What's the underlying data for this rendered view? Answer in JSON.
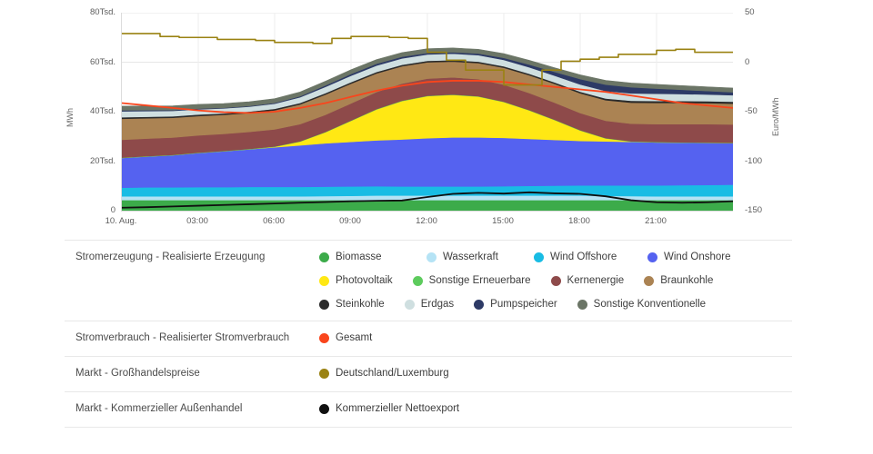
{
  "chart_data": {
    "type": "area",
    "title": "",
    "xlabel": "",
    "ylabel": "MWh",
    "y2label": "Euro/MWh",
    "grid": true,
    "legend_position": "bottom-table",
    "ylim": [
      0,
      80000
    ],
    "y2lim": [
      -150,
      50
    ],
    "y_ticks": [
      "0",
      "20Tsd.",
      "40Tsd.",
      "60Tsd.",
      "80Tsd."
    ],
    "y_tick_values": [
      0,
      20000,
      40000,
      60000,
      80000
    ],
    "y2_ticks": [
      "-150",
      "-100",
      "-50",
      "0",
      "50"
    ],
    "y2_tick_values": [
      -150,
      -100,
      -50,
      0,
      50
    ],
    "x_ticks": [
      "10. Aug.",
      "03:00",
      "06:00",
      "09:00",
      "12:00",
      "15:00",
      "18:00",
      "21:00"
    ],
    "x_hours": [
      0,
      3,
      6,
      9,
      12,
      15,
      18,
      21
    ],
    "x_range_hours": [
      0,
      24
    ],
    "stack_order": [
      "Biomasse",
      "Wasserkraft",
      "Wind Offshore",
      "Wind Onshore",
      "Photovoltaik",
      "Sonstige Erneuerbare",
      "Kernenergie",
      "Braunkohle",
      "Steinkohle",
      "Erdgas",
      "Pumpspeicher",
      "Sonstige Konventionelle"
    ],
    "x": [
      0,
      1,
      2,
      3,
      4,
      5,
      6,
      7,
      8,
      9,
      10,
      11,
      12,
      13,
      14,
      15,
      16,
      17,
      18,
      19,
      20,
      21,
      22,
      23,
      24
    ],
    "series": [
      {
        "name": "Biomasse",
        "color": "#3cab4a",
        "values": [
          4300,
          4300,
          4300,
          4300,
          4300,
          4300,
          4300,
          4300,
          4300,
          4300,
          4300,
          4300,
          4300,
          4300,
          4300,
          4300,
          4300,
          4300,
          4300,
          4300,
          4300,
          4300,
          4300,
          4300,
          4300
        ]
      },
      {
        "name": "Wasserkraft",
        "color": "#b5e3f5",
        "values": [
          1500,
          1500,
          1500,
          1500,
          1500,
          1500,
          1500,
          1500,
          1600,
          1700,
          1800,
          1800,
          1800,
          1800,
          1800,
          1800,
          1800,
          1800,
          1800,
          1700,
          1600,
          1500,
          1500,
          1500,
          1500
        ]
      },
      {
        "name": "Wind Offshore",
        "color": "#19bce4",
        "values": [
          3500,
          3600,
          3600,
          3700,
          3700,
          3800,
          3800,
          3800,
          3800,
          3800,
          3800,
          3700,
          3700,
          3700,
          3700,
          3800,
          3900,
          4000,
          4100,
          4200,
          4300,
          4400,
          4500,
          4600,
          4700
        ]
      },
      {
        "name": "Wind Onshore",
        "color": "#5562f0",
        "values": [
          12000,
          12500,
          13000,
          13800,
          14500,
          15200,
          16000,
          16800,
          17500,
          18000,
          18500,
          19000,
          19500,
          19800,
          19800,
          19500,
          19000,
          18500,
          18000,
          17800,
          17600,
          17400,
          17200,
          17000,
          16800
        ]
      },
      {
        "name": "Photovoltaik",
        "color": "#ffe814",
        "values": [
          0,
          0,
          0,
          0,
          0,
          0,
          200,
          1500,
          4500,
          8500,
          12500,
          15500,
          17000,
          17200,
          16500,
          14500,
          11500,
          8000,
          4200,
          1200,
          100,
          0,
          0,
          0,
          0
        ]
      },
      {
        "name": "Sonstige Erneuerbare",
        "color": "#5dcb5d",
        "values": [
          150,
          150,
          150,
          150,
          150,
          150,
          150,
          150,
          150,
          150,
          150,
          150,
          150,
          150,
          150,
          150,
          150,
          150,
          150,
          150,
          150,
          150,
          150,
          150,
          150
        ]
      },
      {
        "name": "Kernenergie",
        "color": "#8e4a4a",
        "values": [
          7200,
          7100,
          7000,
          7000,
          6900,
          6900,
          6900,
          6900,
          6900,
          6900,
          6900,
          6900,
          6900,
          6900,
          6900,
          6900,
          6900,
          6900,
          6900,
          7000,
          7100,
          7200,
          7300,
          7400,
          7400
        ]
      },
      {
        "name": "Braunkohle",
        "color": "#ab8353",
        "values": [
          8500,
          8200,
          8000,
          7800,
          7700,
          7600,
          7700,
          8000,
          8200,
          8000,
          7500,
          7000,
          6600,
          6400,
          6500,
          6800,
          7200,
          7600,
          8000,
          8300,
          8500,
          8600,
          8600,
          8500,
          8400
        ]
      },
      {
        "name": "Steinkohle",
        "color": "#2b2b2b",
        "values": [
          600,
          600,
          600,
          600,
          600,
          600,
          600,
          600,
          600,
          600,
          600,
          600,
          600,
          600,
          600,
          600,
          600,
          600,
          650,
          700,
          750,
          800,
          800,
          800,
          800
        ]
      },
      {
        "name": "Erdgas",
        "color": "#cfdfe0",
        "values": [
          2400,
          2300,
          2200,
          2100,
          2000,
          2000,
          2100,
          2300,
          2500,
          2600,
          2600,
          2600,
          2600,
          2600,
          2600,
          2600,
          2600,
          2700,
          2900,
          3000,
          3000,
          2900,
          2800,
          2700,
          2600
        ]
      },
      {
        "name": "Pumpspeicher",
        "color": "#2d3a66",
        "values": [
          400,
          350,
          300,
          300,
          250,
          250,
          300,
          400,
          600,
          700,
          700,
          650,
          600,
          600,
          650,
          800,
          1100,
          1500,
          2200,
          2600,
          2500,
          2100,
          1700,
          1400,
          1200
        ]
      },
      {
        "name": "Sonstige Konventionelle",
        "color": "#6b7566",
        "values": [
          1700,
          1700,
          1700,
          1700,
          1700,
          1700,
          1700,
          1700,
          1700,
          1700,
          1700,
          1700,
          1700,
          1700,
          1700,
          1700,
          1700,
          1700,
          1700,
          1700,
          1700,
          1700,
          1700,
          1700,
          1700
        ]
      }
    ],
    "lines": [
      {
        "name": "Gesamt",
        "color": "#f9451c",
        "axis": "left",
        "style": "line",
        "values": [
          43500,
          42500,
          41500,
          40500,
          39800,
          39500,
          40000,
          41500,
          43500,
          46000,
          48500,
          50500,
          52000,
          52500,
          52500,
          52000,
          51000,
          50000,
          49000,
          48000,
          46500,
          45000,
          43500,
          42500,
          41500
        ]
      },
      {
        "name": "Kommerzieller Nettoexport",
        "color": "#101010",
        "axis": "left",
        "style": "line",
        "values": [
          1200,
          1400,
          1700,
          2000,
          2300,
          2600,
          2900,
          3200,
          3500,
          3800,
          4000,
          4100,
          5500,
          6800,
          7200,
          6900,
          7400,
          7000,
          6800,
          5800,
          4200,
          3400,
          3200,
          3400,
          3800
        ]
      },
      {
        "name": "Deutschland/Luxemburg",
        "color": "#9a8212",
        "axis": "right",
        "style": "step",
        "values": [
          29,
          29,
          26,
          25,
          25,
          23,
          23,
          22,
          20,
          20,
          19,
          24,
          26,
          26,
          25,
          24,
          10,
          2,
          -8,
          -8,
          -23,
          -23,
          -8,
          1,
          3,
          5,
          8,
          8,
          12,
          13,
          10,
          10
        ]
      }
    ]
  },
  "axis": {
    "left_title": "MWh",
    "right_title": "Euro/MWh"
  },
  "legend": {
    "rows": [
      {
        "category": "Stromerzeugung - Realisierte Erzeugung",
        "lines": [
          [
            {
              "label": "Biomasse",
              "color": "#3cab4a"
            },
            {
              "label": "Wasserkraft",
              "color": "#b5e3f5"
            },
            {
              "label": "Wind Offshore",
              "color": "#19bce4"
            },
            {
              "label": "Wind Onshore",
              "color": "#5562f0"
            }
          ],
          [
            {
              "label": "Photovoltaik",
              "color": "#ffe814"
            },
            {
              "label": "Sonstige Erneuerbare",
              "color": "#5dcb5d"
            },
            {
              "label": "Kernenergie",
              "color": "#8e4a4a"
            },
            {
              "label": "Braunkohle",
              "color": "#ab8353"
            }
          ],
          [
            {
              "label": "Steinkohle",
              "color": "#2b2b2b"
            },
            {
              "label": "Erdgas",
              "color": "#cfdfe0"
            },
            {
              "label": "Pumpspeicher",
              "color": "#2d3a66"
            },
            {
              "label": "Sonstige Konventionelle",
              "color": "#6b7566"
            }
          ]
        ]
      },
      {
        "category": "Stromverbrauch - Realisierter Stromverbrauch",
        "lines": [
          [
            {
              "label": "Gesamt",
              "color": "#f9451c"
            }
          ]
        ]
      },
      {
        "category": "Markt - Großhandelspreise",
        "lines": [
          [
            {
              "label": "Deutschland/Luxemburg",
              "color": "#9a8212"
            }
          ]
        ]
      },
      {
        "category": "Markt - Kommerzieller Außenhandel",
        "lines": [
          [
            {
              "label": "Kommerzieller Nettoexport",
              "color": "#101010"
            }
          ]
        ]
      }
    ]
  }
}
